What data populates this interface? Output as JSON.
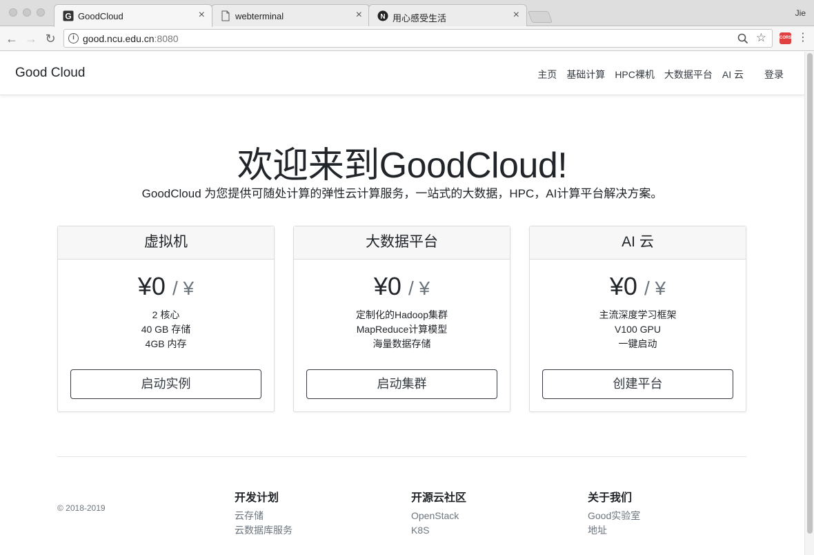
{
  "browser": {
    "tabs": [
      {
        "title": "GoodCloud",
        "favicon": "g-favicon-icon",
        "active": true
      },
      {
        "title": "webterminal",
        "favicon": "document-icon",
        "active": false
      },
      {
        "title": "用心感受生活",
        "favicon": "n-favicon-icon",
        "active": false
      }
    ],
    "profile_name": "Jie",
    "url_host": "good.ncu.edu.cn",
    "url_port": ":8080",
    "extension_label": "CORS"
  },
  "site": {
    "brand": "Good Cloud",
    "nav": [
      "主页",
      "基础计算",
      "HPC裸机",
      "大数据平台",
      "AI 云"
    ],
    "login": "登录"
  },
  "hero": {
    "title": "欢迎来到GoodCloud!",
    "lead": "GoodCloud 为您提供可随处计算的弹性云计算服务，一站式的大数据，HPC，AI计算平台解决方案。"
  },
  "cards": [
    {
      "header": "虚拟机",
      "price": "¥0",
      "price_suffix": "/ ¥",
      "features": [
        "2 核心",
        "40 GB 存储",
        "4GB 内存"
      ],
      "button": "启动实例"
    },
    {
      "header": "大数据平台",
      "price": "¥0",
      "price_suffix": "/ ¥",
      "features": [
        "定制化的Hadoop集群",
        "MapReduce计算模型",
        "海量数据存储"
      ],
      "button": "启动集群"
    },
    {
      "header": "AI 云",
      "price": "¥0",
      "price_suffix": "/ ¥",
      "features": [
        "主流深度学习框架",
        "V100 GPU",
        "一键启动"
      ],
      "button": "创建平台"
    }
  ],
  "footer": {
    "copyright": "© 2018-2019",
    "columns": [
      {
        "title": "开发计划",
        "links": [
          "云存储",
          "云数据库服务"
        ]
      },
      {
        "title": "开源云社区",
        "links": [
          "OpenStack",
          "K8S"
        ]
      },
      {
        "title": "关于我们",
        "links": [
          "Good实验室",
          "地址"
        ]
      }
    ]
  }
}
